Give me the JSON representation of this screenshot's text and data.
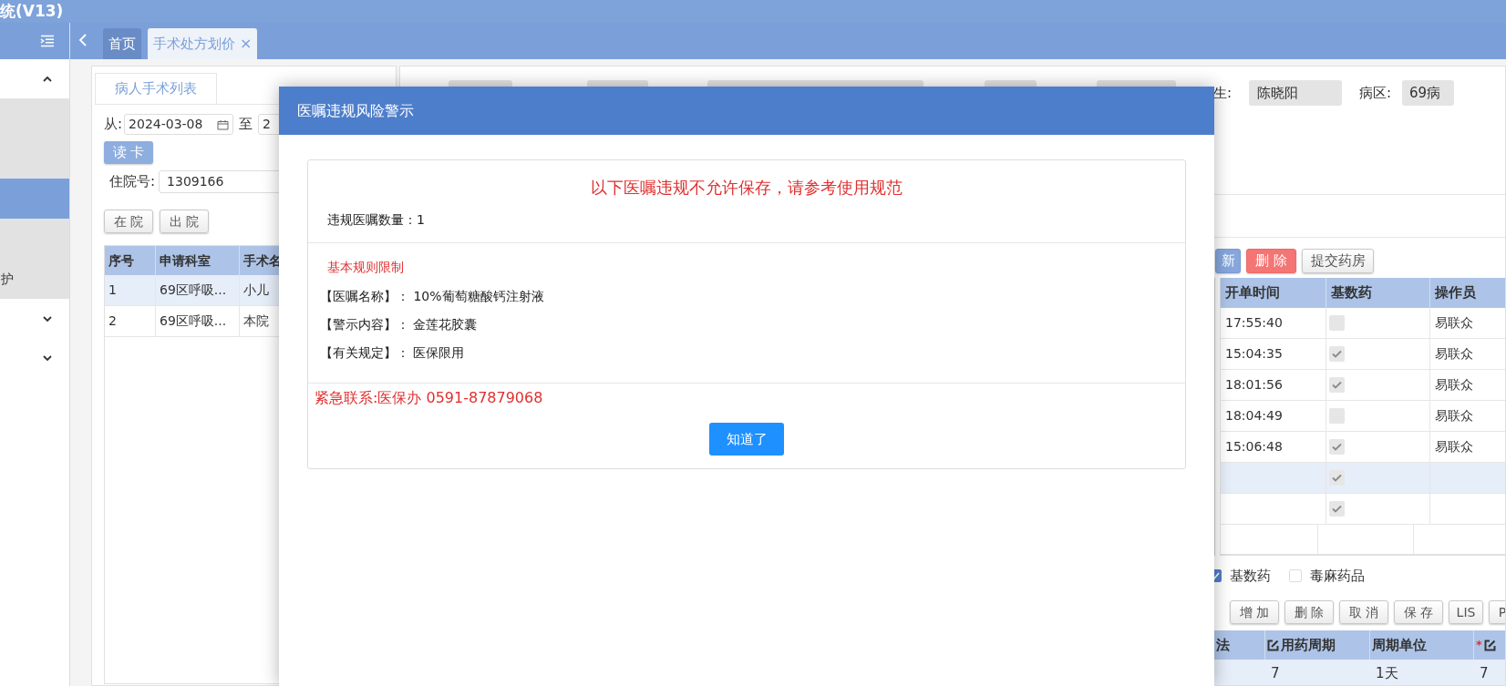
{
  "title_bar": {
    "title": "统(V13)"
  },
  "sidebar": {
    "groups": [
      {
        "expanded": true,
        "items": [
          {
            "selected": false
          },
          {
            "selected": false
          },
          {
            "selected": true
          },
          {
            "selected": false
          },
          {
            "label": "护",
            "selected": false
          }
        ]
      },
      {
        "expanded": false
      },
      {
        "expanded": false
      }
    ]
  },
  "tabs": [
    {
      "label": "首页",
      "selected": false
    },
    {
      "label": "手术处方划价",
      "selected": true,
      "close": "×"
    }
  ],
  "patient_panel": {
    "tab": "病人手术列表",
    "from_label": "从:",
    "from_date": "2024-03-08",
    "to_label": "至",
    "to_date": "2",
    "read_card_button": "读 卡",
    "admission_label": "住院号:",
    "admission_no": "1309166",
    "filter_buttons": [
      "在 院",
      "出 院"
    ],
    "table": {
      "columns": [
        "序号",
        "申请科室",
        "手术名"
      ],
      "rows": [
        {
          "cells": [
            "1",
            "69区呼吸...",
            "小儿"
          ],
          "selected": true
        },
        {
          "cells": [
            "2",
            "69区呼吸...",
            "本院"
          ],
          "selected": false
        }
      ]
    }
  },
  "info_bar": {
    "doctor_label": "生:",
    "doctor": "陈晓阳",
    "ward_label": "病区:",
    "ward": "69病"
  },
  "order_buttons": [
    {
      "label": "新",
      "kind": "primary"
    },
    {
      "label": "删 除",
      "kind": "danger"
    },
    {
      "label": "提交药房",
      "kind": "default"
    }
  ],
  "order_table": {
    "columns": [
      "开单时间",
      "基数药",
      "操作员"
    ],
    "rows": [
      {
        "time": "17:55:40",
        "basic": false,
        "operator": "易联众",
        "selected": false
      },
      {
        "time": "15:04:35",
        "basic": true,
        "operator": "易联众",
        "selected": false
      },
      {
        "time": "18:01:56",
        "basic": true,
        "operator": "易联众",
        "selected": false
      },
      {
        "time": "18:04:49",
        "basic": false,
        "operator": "易联众",
        "selected": false
      },
      {
        "time": "15:06:48",
        "basic": true,
        "operator": "易联众",
        "selected": false
      },
      {
        "basic": true,
        "selected": true
      },
      {
        "basic": true,
        "selected": false
      }
    ]
  },
  "filters": [
    {
      "label": "基数药",
      "checked": true
    },
    {
      "label": "毒麻药品",
      "checked": false
    }
  ],
  "detail_buttons": [
    "增 加",
    "删 除",
    "取 消",
    "保 存",
    "LIS",
    "P"
  ],
  "detail_table": {
    "columns": [
      {
        "label": "法",
        "editable": false
      },
      {
        "label": "用药周期",
        "editable": true
      },
      {
        "label": "周期单位",
        "editable": false
      },
      {
        "required_mark": "*",
        "editable": true
      }
    ],
    "rows": [
      {
        "cells": [
          "",
          "7",
          "1天",
          "7"
        ]
      }
    ]
  },
  "alert_dialog": {
    "title": "医嘱违规风险警示",
    "heading": "以下医嘱违规不允许保存，请参考使用规范",
    "count_label": "违规医嘱数量：",
    "count": "1",
    "rule_title": "基本规则限制",
    "details": [
      {
        "label": "【医嘱名称】：",
        "value": "10%葡萄糖酸钙注射液"
      },
      {
        "label": "【警示内容】：",
        "value": "金莲花胶囊"
      },
      {
        "label": "【有关规定】：",
        "value": "医保限用"
      }
    ],
    "contact": "紧急联系:医保办 0591-87879068",
    "button": "知道了"
  }
}
